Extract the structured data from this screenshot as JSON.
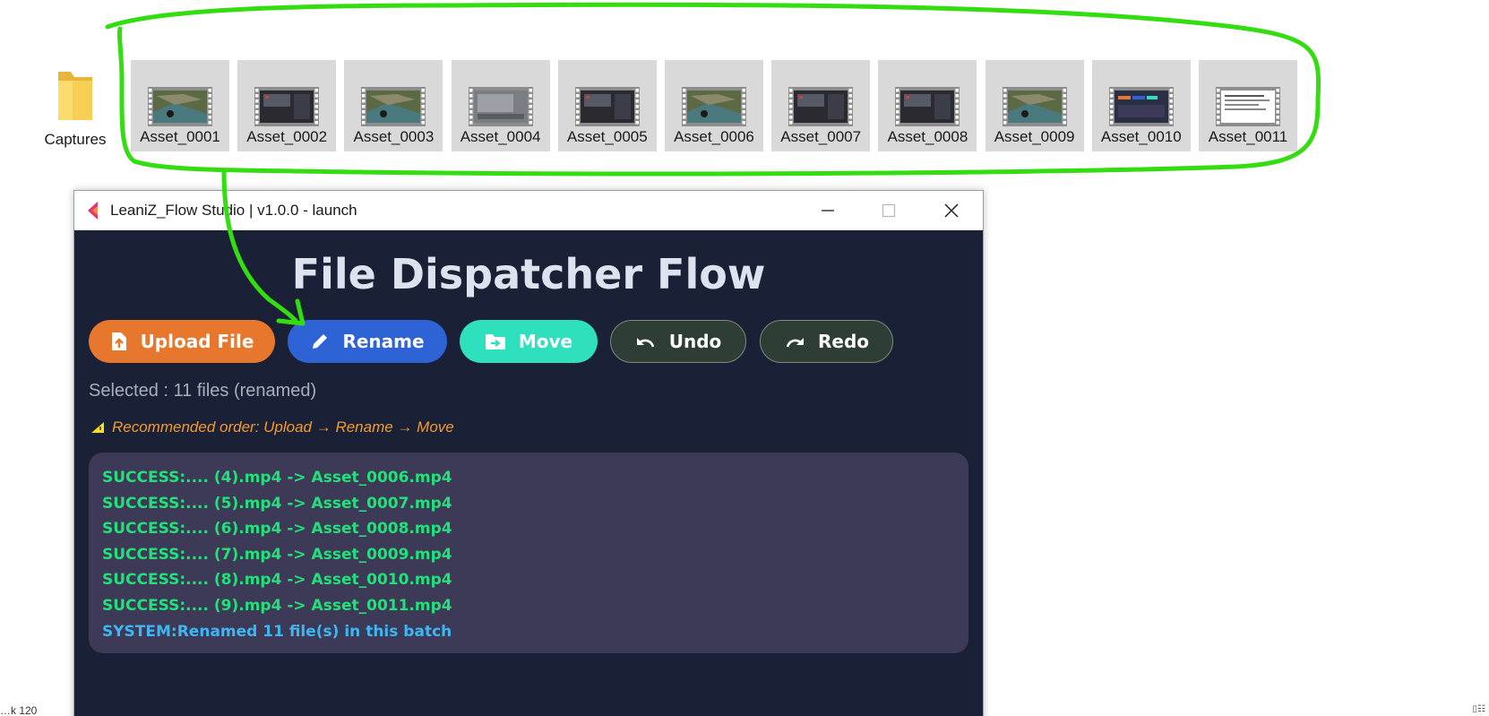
{
  "desktop": {
    "folder_label": "Captures",
    "assets": [
      {
        "name": "Asset_0001",
        "thumb": "aerial"
      },
      {
        "name": "Asset_0002",
        "thumb": "dark-ui"
      },
      {
        "name": "Asset_0003",
        "thumb": "aerial"
      },
      {
        "name": "Asset_0004",
        "thumb": "grey"
      },
      {
        "name": "Asset_0005",
        "thumb": "dark-ui"
      },
      {
        "name": "Asset_0006",
        "thumb": "aerial"
      },
      {
        "name": "Asset_0007",
        "thumb": "dark-ui"
      },
      {
        "name": "Asset_0008",
        "thumb": "dark-ui"
      },
      {
        "name": "Asset_0009",
        "thumb": "aerial"
      },
      {
        "name": "Asset_0010",
        "thumb": "app-ui"
      },
      {
        "name": "Asset_0011",
        "thumb": "white-doc"
      }
    ],
    "taskbar_fragment": "…k 120",
    "corner_fragment": "▯☷"
  },
  "window": {
    "title": "LeaniZ_Flow Studio | v1.0.0 - launch",
    "controls": {
      "minimize": "minimize",
      "maximize": "maximize",
      "close": "close"
    }
  },
  "app": {
    "heading": "File Dispatcher Flow",
    "buttons": {
      "upload": "Upload File",
      "rename": "Rename",
      "move": "Move",
      "undo": "Undo",
      "redo": "Redo"
    },
    "selected_text": "Selected : 11 files (renamed)",
    "recommended_text": "Recommended order: Upload → Rename → Move",
    "log": [
      {
        "text": "SUCCESS:.... (4).mp4 -> Asset_0006.mp4",
        "kind": "success"
      },
      {
        "text": "SUCCESS:.... (5).mp4 -> Asset_0007.mp4",
        "kind": "success"
      },
      {
        "text": "SUCCESS:.... (6).mp4 -> Asset_0008.mp4",
        "kind": "success"
      },
      {
        "text": "SUCCESS:.... (7).mp4 -> Asset_0009.mp4",
        "kind": "success"
      },
      {
        "text": "SUCCESS:.... (8).mp4 -> Asset_0010.mp4",
        "kind": "success"
      },
      {
        "text": "SUCCESS:.... (9).mp4 -> Asset_0011.mp4",
        "kind": "success"
      },
      {
        "text": "SYSTEM:Renamed 11 file(s) in this batch",
        "kind": "system"
      }
    ]
  },
  "colors": {
    "window_bg": "#1a2137",
    "upload": "#e8772e",
    "rename": "#2e63d6",
    "move": "#2ee0bd",
    "undo_redo": "#2f3e34",
    "log_bg": "#3d3a57",
    "success": "#23e07a",
    "system": "#3fb6f2",
    "annotation": "#33dd11"
  }
}
